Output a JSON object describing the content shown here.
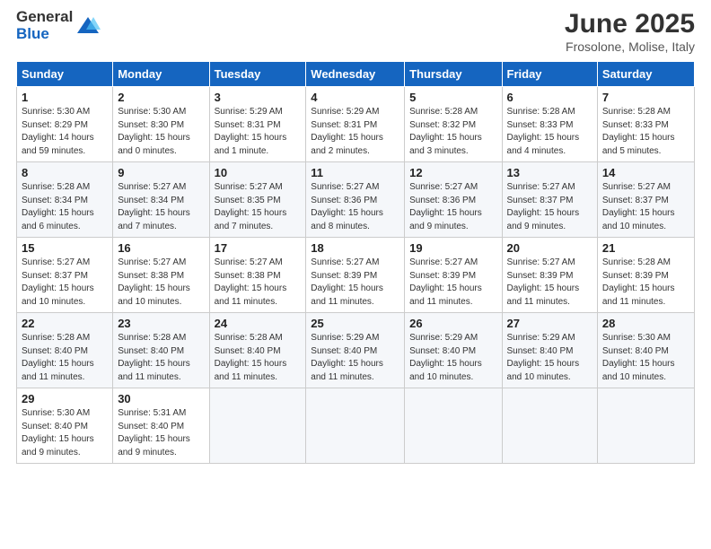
{
  "logo": {
    "general": "General",
    "blue": "Blue"
  },
  "title": "June 2025",
  "subtitle": "Frosolone, Molise, Italy",
  "header_days": [
    "Sunday",
    "Monday",
    "Tuesday",
    "Wednesday",
    "Thursday",
    "Friday",
    "Saturday"
  ],
  "weeks": [
    [
      {
        "day": "1",
        "info": "Sunrise: 5:30 AM\nSunset: 8:29 PM\nDaylight: 14 hours\nand 59 minutes."
      },
      {
        "day": "2",
        "info": "Sunrise: 5:30 AM\nSunset: 8:30 PM\nDaylight: 15 hours\nand 0 minutes."
      },
      {
        "day": "3",
        "info": "Sunrise: 5:29 AM\nSunset: 8:31 PM\nDaylight: 15 hours\nand 1 minute."
      },
      {
        "day": "4",
        "info": "Sunrise: 5:29 AM\nSunset: 8:31 PM\nDaylight: 15 hours\nand 2 minutes."
      },
      {
        "day": "5",
        "info": "Sunrise: 5:28 AM\nSunset: 8:32 PM\nDaylight: 15 hours\nand 3 minutes."
      },
      {
        "day": "6",
        "info": "Sunrise: 5:28 AM\nSunset: 8:33 PM\nDaylight: 15 hours\nand 4 minutes."
      },
      {
        "day": "7",
        "info": "Sunrise: 5:28 AM\nSunset: 8:33 PM\nDaylight: 15 hours\nand 5 minutes."
      }
    ],
    [
      {
        "day": "8",
        "info": "Sunrise: 5:28 AM\nSunset: 8:34 PM\nDaylight: 15 hours\nand 6 minutes."
      },
      {
        "day": "9",
        "info": "Sunrise: 5:27 AM\nSunset: 8:34 PM\nDaylight: 15 hours\nand 7 minutes."
      },
      {
        "day": "10",
        "info": "Sunrise: 5:27 AM\nSunset: 8:35 PM\nDaylight: 15 hours\nand 7 minutes."
      },
      {
        "day": "11",
        "info": "Sunrise: 5:27 AM\nSunset: 8:36 PM\nDaylight: 15 hours\nand 8 minutes."
      },
      {
        "day": "12",
        "info": "Sunrise: 5:27 AM\nSunset: 8:36 PM\nDaylight: 15 hours\nand 9 minutes."
      },
      {
        "day": "13",
        "info": "Sunrise: 5:27 AM\nSunset: 8:37 PM\nDaylight: 15 hours\nand 9 minutes."
      },
      {
        "day": "14",
        "info": "Sunrise: 5:27 AM\nSunset: 8:37 PM\nDaylight: 15 hours\nand 10 minutes."
      }
    ],
    [
      {
        "day": "15",
        "info": "Sunrise: 5:27 AM\nSunset: 8:37 PM\nDaylight: 15 hours\nand 10 minutes."
      },
      {
        "day": "16",
        "info": "Sunrise: 5:27 AM\nSunset: 8:38 PM\nDaylight: 15 hours\nand 10 minutes."
      },
      {
        "day": "17",
        "info": "Sunrise: 5:27 AM\nSunset: 8:38 PM\nDaylight: 15 hours\nand 11 minutes."
      },
      {
        "day": "18",
        "info": "Sunrise: 5:27 AM\nSunset: 8:39 PM\nDaylight: 15 hours\nand 11 minutes."
      },
      {
        "day": "19",
        "info": "Sunrise: 5:27 AM\nSunset: 8:39 PM\nDaylight: 15 hours\nand 11 minutes."
      },
      {
        "day": "20",
        "info": "Sunrise: 5:27 AM\nSunset: 8:39 PM\nDaylight: 15 hours\nand 11 minutes."
      },
      {
        "day": "21",
        "info": "Sunrise: 5:28 AM\nSunset: 8:39 PM\nDaylight: 15 hours\nand 11 minutes."
      }
    ],
    [
      {
        "day": "22",
        "info": "Sunrise: 5:28 AM\nSunset: 8:40 PM\nDaylight: 15 hours\nand 11 minutes."
      },
      {
        "day": "23",
        "info": "Sunrise: 5:28 AM\nSunset: 8:40 PM\nDaylight: 15 hours\nand 11 minutes."
      },
      {
        "day": "24",
        "info": "Sunrise: 5:28 AM\nSunset: 8:40 PM\nDaylight: 15 hours\nand 11 minutes."
      },
      {
        "day": "25",
        "info": "Sunrise: 5:29 AM\nSunset: 8:40 PM\nDaylight: 15 hours\nand 11 minutes."
      },
      {
        "day": "26",
        "info": "Sunrise: 5:29 AM\nSunset: 8:40 PM\nDaylight: 15 hours\nand 10 minutes."
      },
      {
        "day": "27",
        "info": "Sunrise: 5:29 AM\nSunset: 8:40 PM\nDaylight: 15 hours\nand 10 minutes."
      },
      {
        "day": "28",
        "info": "Sunrise: 5:30 AM\nSunset: 8:40 PM\nDaylight: 15 hours\nand 10 minutes."
      }
    ],
    [
      {
        "day": "29",
        "info": "Sunrise: 5:30 AM\nSunset: 8:40 PM\nDaylight: 15 hours\nand 9 minutes."
      },
      {
        "day": "30",
        "info": "Sunrise: 5:31 AM\nSunset: 8:40 PM\nDaylight: 15 hours\nand 9 minutes."
      },
      {
        "day": "",
        "info": ""
      },
      {
        "day": "",
        "info": ""
      },
      {
        "day": "",
        "info": ""
      },
      {
        "day": "",
        "info": ""
      },
      {
        "day": "",
        "info": ""
      }
    ]
  ]
}
